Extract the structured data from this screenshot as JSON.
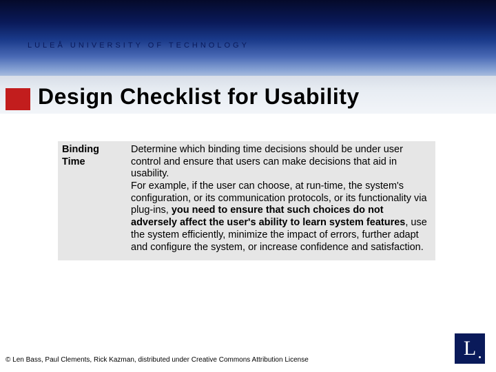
{
  "university": "LULEÅ UNIVERSITY OF TECHNOLOGY",
  "title": "Design Checklist for Usability",
  "row": {
    "label": "Binding Time",
    "desc_part1": "Determine which binding time decisions should be under user control and ensure that users can make decisions that aid in usability.",
    "desc_part2a": "For example, if the user can choose, at run-time, the system's configuration, or its communication protocols, or its functionality via plug-ins, ",
    "desc_bold": "you need to ensure that such choices do not adversely affect the user's ability to learn system features",
    "desc_part2b": ", use the system efficiently, minimize the impact of errors, further adapt and configure the system, or increase confidence and satisfaction."
  },
  "footer": "© Len Bass, Paul Clements, Rick Kazman, distributed under Creative Commons Attribution License",
  "logo_letter": "L"
}
